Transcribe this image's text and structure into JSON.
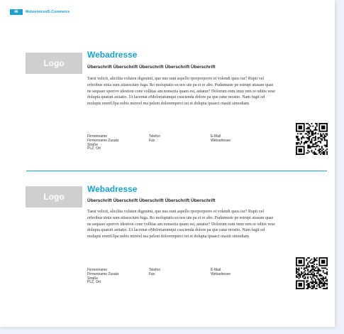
{
  "header": {
    "page_number": "46",
    "section": "Webservices/E-Commerce"
  },
  "entries": [
    {
      "logo": "Logo",
      "web": "Webadresse",
      "heading": "Überschrift Überschrift Überschrift Überschrift Überschrift",
      "body": "Taest velicit, alicilita voluten digenimi, que nus sunt aspello rporporporro et volendi quos iur? Rupit vel erferibus sinia sum atiaescium fuga. Ro moluptatis ea nos ute pa et re abo. Pudamuste pe estrupt atusam quae ne sequaer sperrov idestion cone vollitas am nonseria quam est, autatur? Dolorum eum imin rem re oditis vese dolupta quaturi asitatio. Ut lacernat eMoloriatumqui cuscienda dolore pa que ratur mostio. Nam fugit od molupis eremUlpa nobis minvel ma pelent doloremperci tet et dolupta ipsaect otasiti simodiam",
      "contact": {
        "col1": [
          "Firmenname",
          "Firmenname Zusatz",
          "Straße",
          "PLZ, Ort"
        ],
        "col2": [
          "Telefon",
          "Fax"
        ],
        "col3": [
          "E-Mail",
          "Webadresse"
        ]
      }
    },
    {
      "logo": "Logo",
      "web": "Webadresse",
      "heading": "Überschrift Überschrift Überschrift Überschrift Überschrift",
      "body": "Taest velicit, alicilita voluten digenimi, que nus sunt aspello rporporporro et volendi quos iur? Rupit vel erferibus sinia sum atiaescium fuga. Ro moluptatis ea nos ute pa et re abo. Pudamuste pe estrupt atusam quae ne sequaer sperrov idestion cone vollitas am nonseria quam est, autatur? Dolorum eum imin rem re oditis vese dolupta quaturi asitatio. Ut lacernat eMoloriatumqui cuscienda dolore pa que ratur mostio. Nam fugit od molupis eremUlpa nobis minvel ma pelent doloremperci tet et dolupta ipsaect otasiti simodiam",
      "contact": {
        "col1": [
          "Firmenname",
          "Firmenname Zusatz",
          "Straße",
          "PLZ, Ort"
        ],
        "col2": [
          "Telefon",
          "Fax"
        ],
        "col3": [
          "E-Mail",
          "Webadresse"
        ]
      }
    }
  ],
  "colors": {
    "accent": "#1aa0cf",
    "logo_bg": "#cfcfcf"
  }
}
